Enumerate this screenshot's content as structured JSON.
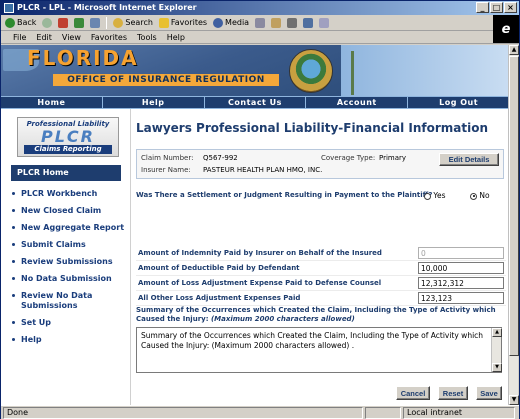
{
  "window": {
    "title": "PLCR - LPL - Microsoft Internet Explorer",
    "controls": [
      "_",
      "□",
      "×"
    ]
  },
  "toolbar": {
    "back": "Back",
    "search": "Search",
    "favorites": "Favorites",
    "media": "Media"
  },
  "menu": [
    "File",
    "Edit",
    "View",
    "Favorites",
    "Tools",
    "Help"
  ],
  "banner": {
    "title": "FLORIDA",
    "subtitle": "OFFICE OF INSURANCE REGULATION"
  },
  "nav": [
    "Home",
    "Help",
    "Contact Us",
    "Account",
    "Log Out"
  ],
  "logo": {
    "line1": "Professional Liability",
    "line2": "PLCR",
    "line3": "Claims Reporting"
  },
  "sidebar": {
    "home_label": "PLCR Home",
    "items": [
      "PLCR Workbench",
      "New Closed Claim",
      "New Aggregate Report",
      "Submit Claims",
      "Review Submissions",
      "No Data Submission",
      "Review No Data Submissions",
      "Set Up",
      "Help"
    ]
  },
  "main": {
    "title": "Lawyers Professional Liability-Financial Information",
    "claim": {
      "claim_number_label": "Claim Number:",
      "claim_number": "Q567-992",
      "coverage_label": "Coverage Type:",
      "coverage": "Primary",
      "insurer_label": "Insurer Name:",
      "insurer": "PASTEUR HEALTH PLAN HMO, INC.",
      "edit_button": "Edit Details"
    },
    "settlement_question": "Was There a Settlement or Judgment Resulting in Payment to the Plaintiff?",
    "settlement_options": [
      "Yes",
      "No"
    ],
    "settlement_selected": "No",
    "fields": [
      {
        "label": "Amount of Indemnity Paid by Insurer on Behalf of the Insured",
        "value": "0",
        "disabled": true
      },
      {
        "label": "Amount of Deductible Paid by Defendant",
        "value": "10,000",
        "disabled": false
      },
      {
        "label": "Amount of Loss Adjustment Expense Paid to Defense Counsel",
        "value": "12,312,312",
        "disabled": false
      },
      {
        "label": "All Other Loss Adjustment Expenses Paid",
        "value": "123,123",
        "disabled": false
      }
    ],
    "summary_label": "Summary of the Occurrences which Created the Claim, Including the Type of Activity which Caused the Injury:",
    "summary_hint": "(Maximum 2000 characters allowed)",
    "summary_value": "Summary of the Occurrences which Created the Claim, Including the Type of Activity which Caused the Injury: (Maximum 2000 characters allowed) .",
    "buttons": {
      "cancel": "Cancel",
      "reset": "Reset",
      "save": "Save"
    }
  },
  "status": {
    "left": "Done",
    "zone": "Local intranet"
  }
}
